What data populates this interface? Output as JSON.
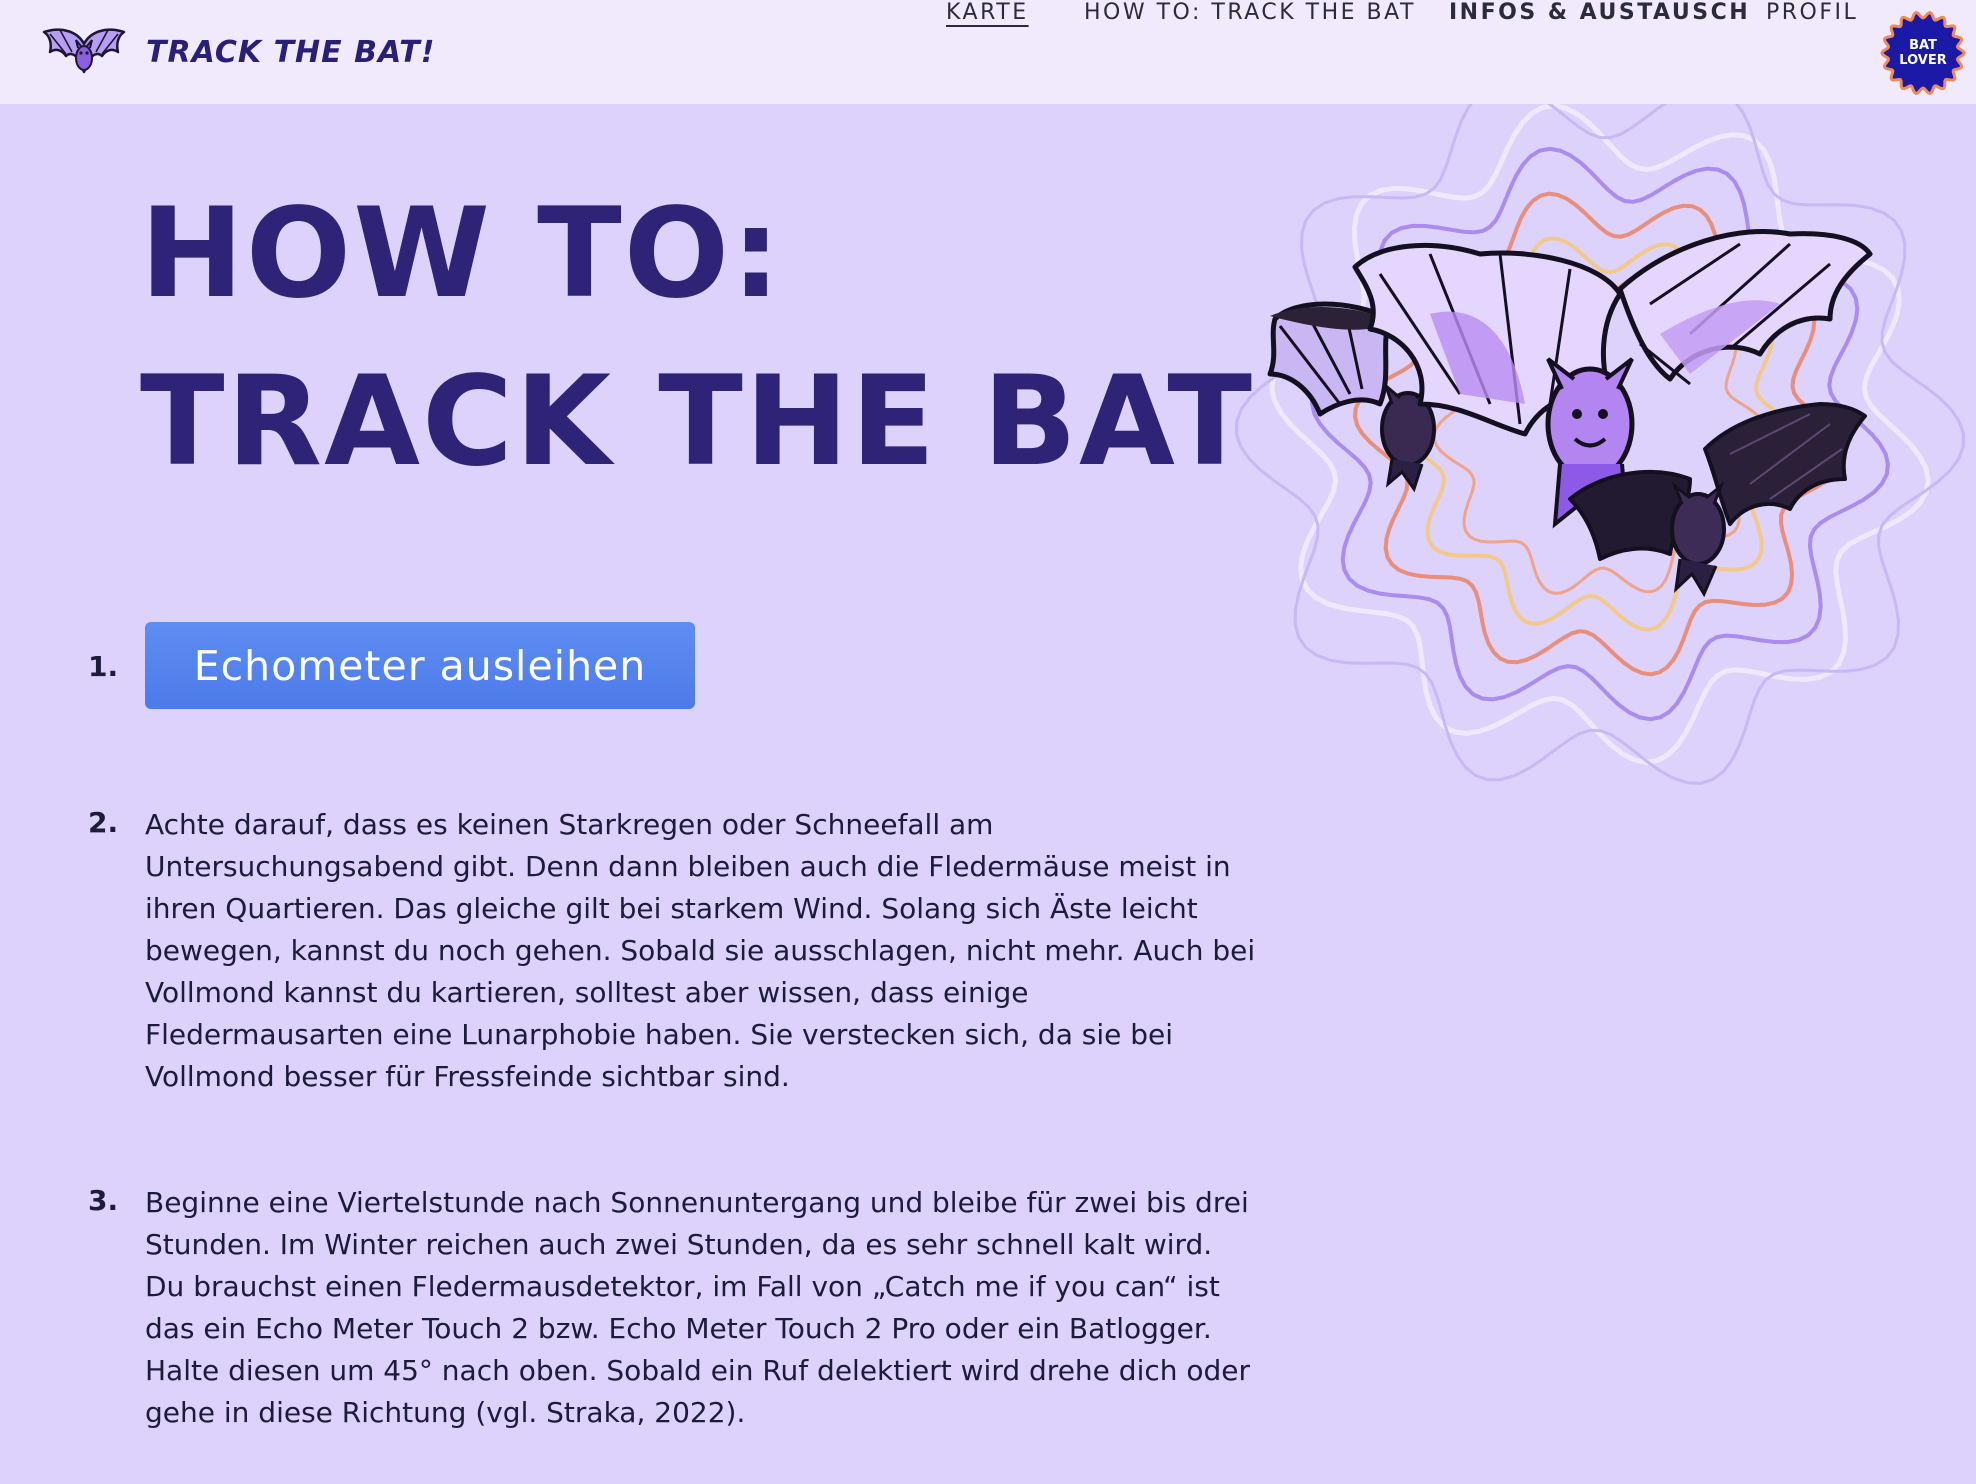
{
  "header": {
    "brand": "TRACK THE BAT!",
    "nav": [
      {
        "label": "KARTE"
      },
      {
        "label": "HOW TO: TRACK THE BAT"
      },
      {
        "label": "INFOS & AUSTAUSCH"
      },
      {
        "label": "PROFIL"
      }
    ],
    "badge_line1": "BAT",
    "badge_line2": "LOVER"
  },
  "hero": {
    "title_line1": "HOW TO:",
    "title_line2": "TRACK THE BAT"
  },
  "steps": [
    {
      "number": "1.",
      "button_label": "Echometer ausleihen"
    },
    {
      "number": "2.",
      "text": "Achte darauf, dass es keinen Starkregen oder Schneefall am\nUntersuchungsabend gibt. Denn dann bleiben auch die Fledermäuse meist in\nihren Quartieren. Das gleiche gilt bei starkem Wind. Solang sich Äste leicht\nbewegen, kannst du noch gehen. Sobald sie ausschlagen, nicht mehr. Auch bei\nVollmond kannst du kartieren, solltest aber wissen, dass einige\nFledermausarten eine Lunarphobie haben. Sie verstecken sich, da sie bei\nVollmond besser für Fressfeinde sichtbar sind."
    },
    {
      "number": "3.",
      "text": "Beginne eine Viertelstunde nach Sonnenuntergang und bleibe für zwei bis drei\nStunden. Im Winter reichen auch zwei Stunden, da es sehr schnell kalt wird.\nDu brauchst einen Fledermausdetektor, im Fall von „Catch me if you can“ ist\ndas ein Echo Meter Touch 2 bzw. Echo Meter Touch 2 Pro oder ein Batlogger.\nHalte diesen um 45° nach oben. Sobald ein Ruf delektiert wird drehe dich oder\ngehe in diese Richtung (vgl. Straka, 2022)."
    }
  ],
  "colors": {
    "background": "#dcd2fb",
    "topbar": "#f1eafd",
    "headline": "#2f2378",
    "button": "#5a89f0",
    "badge": "#1b1aa6"
  },
  "icons": [
    "bat-logo-icon",
    "bat-lover-badge-icon",
    "bat-illustration"
  ]
}
